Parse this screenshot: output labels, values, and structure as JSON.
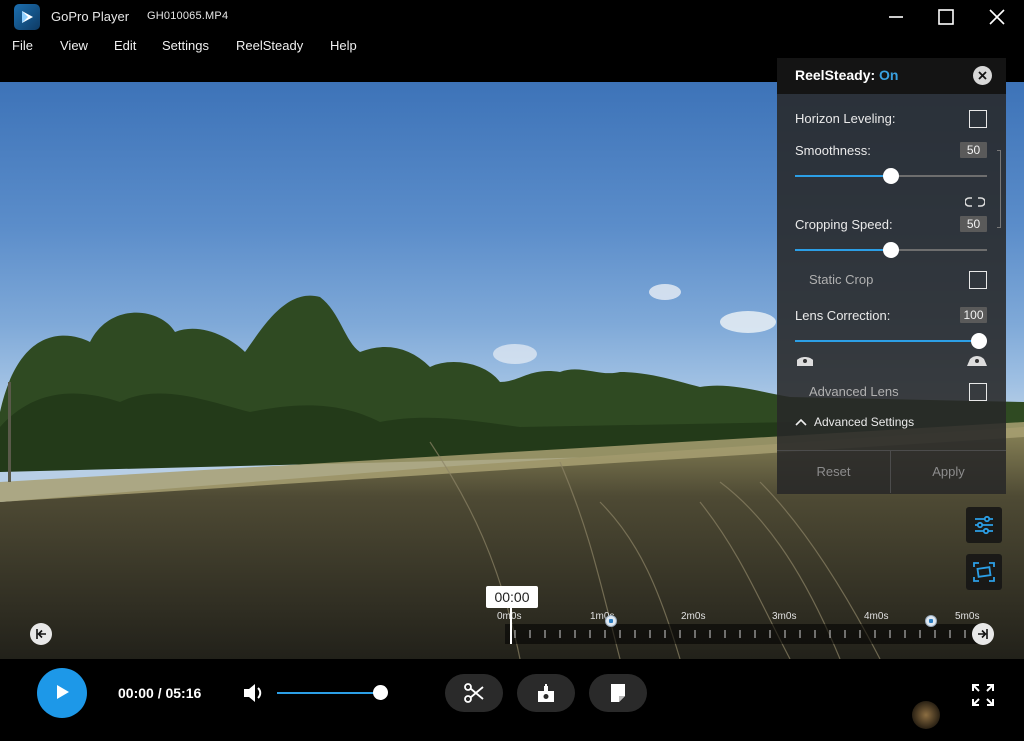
{
  "window": {
    "app_title": "GoPro Player",
    "file_name": "GH010065.MP4"
  },
  "menu": {
    "items": [
      "File",
      "View",
      "Edit",
      "Settings",
      "ReelSteady",
      "Help"
    ]
  },
  "reelsteady_panel": {
    "title": "ReelSteady:",
    "state": "On",
    "horizon_leveling_label": "Horizon Leveling:",
    "horizon_leveling_checked": false,
    "smoothness_label": "Smoothness:",
    "smoothness_value": "50",
    "cropping_speed_label": "Cropping Speed:",
    "cropping_speed_value": "50",
    "static_crop_label": "Static Crop",
    "static_crop_checked": false,
    "lens_correction_label": "Lens Correction:",
    "lens_correction_value": "100",
    "advanced_lens_label": "Advanced Lens",
    "advanced_lens_checked": false,
    "advanced_settings_label": "Advanced Settings",
    "reset_label": "Reset",
    "apply_label": "Apply"
  },
  "timeline": {
    "current_badge": "00:00",
    "tick_labels": [
      "0m0s",
      "1m0s",
      "2m0s",
      "3m0s",
      "4m0s",
      "5m0s"
    ]
  },
  "controls": {
    "timecode": "00:00 / 05:16",
    "volume_fraction": 0.93
  },
  "colors": {
    "accent": "#2c9fe6",
    "play_button": "#1d98e8",
    "panel_bg": "#282828"
  },
  "icons": {
    "logo": "gopro-play-logo-icon",
    "minimize": "minimize-icon",
    "maximize": "maximize-icon",
    "close": "close-icon",
    "panel_close": "close-circle-icon",
    "link": "link-icon",
    "lens_narrow": "lens-narrow-icon",
    "lens_wide": "lens-wide-icon",
    "chevron": "chevron-up-icon",
    "adjust": "sliders-icon",
    "frame": "frame-crop-icon",
    "go_start": "skip-to-start-icon",
    "go_end": "skip-to-end-icon",
    "play": "play-icon",
    "volume": "volume-icon",
    "trim": "scissors-icon",
    "snapshot": "frame-grab-icon",
    "export": "export-icon",
    "fullscreen": "fullscreen-icon"
  }
}
